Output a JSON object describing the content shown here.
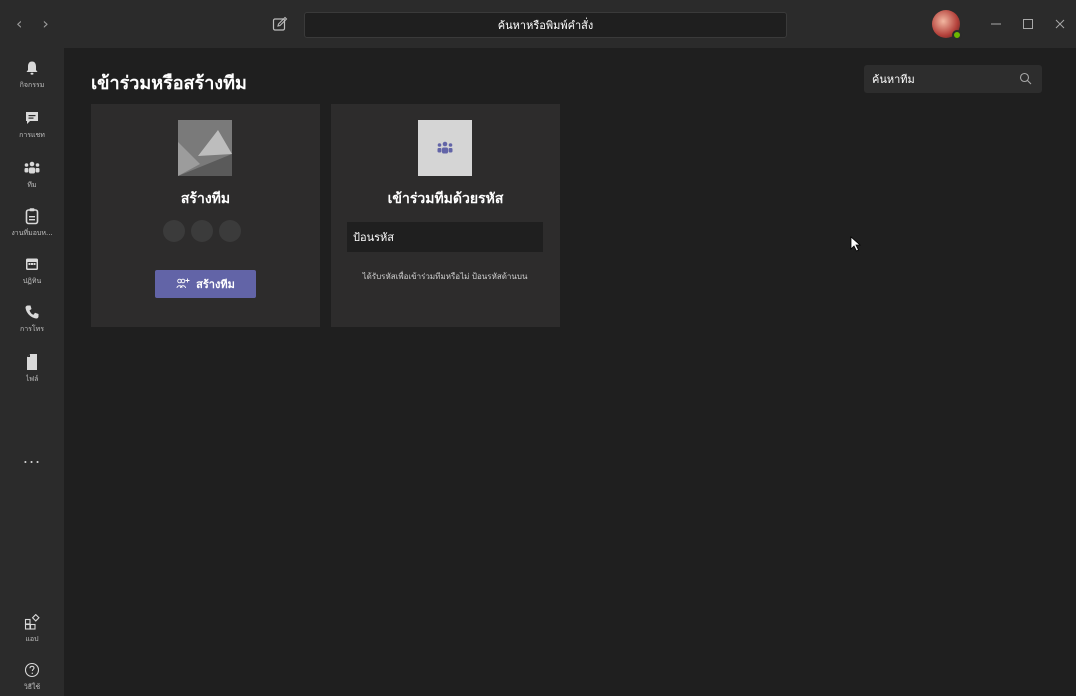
{
  "titlebar": {
    "search_text": "ค้นหาหรือพิมพ์คำสั่ง"
  },
  "rail": {
    "items": [
      {
        "label": "กิจกรรม",
        "icon": "bell-icon"
      },
      {
        "label": "การแชท",
        "icon": "chat-icon"
      },
      {
        "label": "ทีม",
        "icon": "teams-icon"
      },
      {
        "label": "งานที่มอบห...",
        "icon": "assignments-icon"
      },
      {
        "label": "ปฏิทิน",
        "icon": "calendar-icon"
      },
      {
        "label": "การโทร",
        "icon": "phone-icon"
      },
      {
        "label": "ไฟล์",
        "icon": "file-icon"
      }
    ],
    "more": "...",
    "apps_label": "แอป",
    "help_label": "วิธีใช้"
  },
  "main": {
    "title": "เข้าร่วมหรือสร้างทีม",
    "team_search_placeholder": "ค้นหาทีม",
    "create_card": {
      "title": "สร้างทีม",
      "button_label": "สร้างทีม"
    },
    "join_card": {
      "title": "เข้าร่วมทีมด้วยรหัส",
      "input_placeholder": "ป้อนรหัส",
      "hint": "ได้รับรหัสเพื่อเข้าร่วมทีมหรือไม่ ป้อนรหัสด้านบน"
    }
  },
  "colors": {
    "accent": "#6264a7",
    "rail_bg": "#2b2b2b",
    "main_bg": "#1f1f1f",
    "card_bg": "#2d2c2c",
    "presence": "#6bb700"
  }
}
